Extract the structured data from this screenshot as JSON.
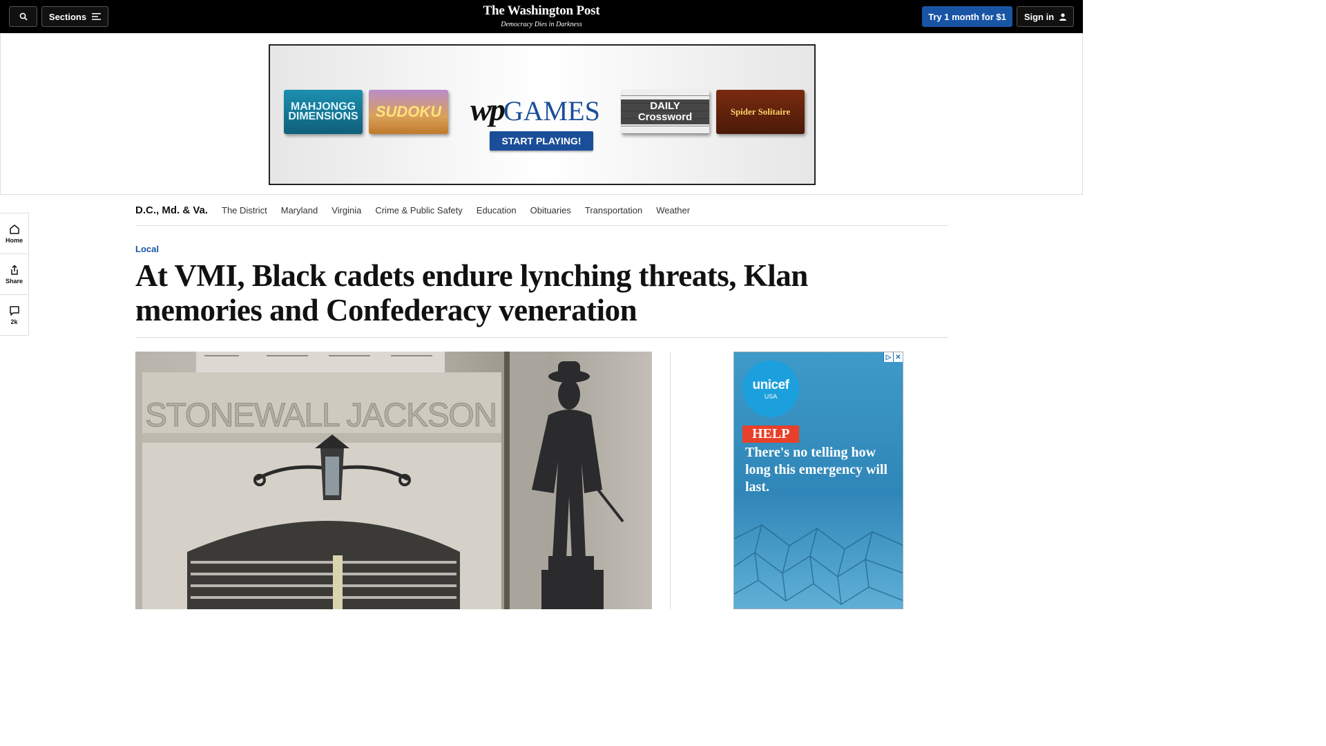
{
  "header": {
    "sections_label": "Sections",
    "brand_name": "The Washington Post",
    "brand_tagline": "Democracy Dies in Darkness",
    "trial_label": "Try 1 month for $1",
    "signin_label": "Sign in"
  },
  "ad_banner": {
    "tiles": [
      "MAHJONGG DIMENSIONS",
      "SUDOKU",
      "DAILY Crossword",
      "Spider Solitaire"
    ],
    "logo_wp": "wp",
    "logo_games": "GAMES",
    "cta": "START PLAYING!"
  },
  "section_nav": {
    "home": "D.C., Md. & Va.",
    "items": [
      "The District",
      "Maryland",
      "Virginia",
      "Crime & Public Safety",
      "Education",
      "Obituaries",
      "Transportation",
      "Weather"
    ]
  },
  "rail": {
    "home_label": "Home",
    "share_label": "Share",
    "comments_count": "2k"
  },
  "article": {
    "kicker": "Local",
    "headline": "At VMI, Black cadets endure lynching threats, Klan memories and Confederacy veneration",
    "photo_inscription": "STONEWALL JACKSON"
  },
  "side_ad": {
    "brand": "unicef",
    "brand_sub": "USA",
    "tag": "HELP",
    "copy": "There's no telling how long this emergency will last."
  }
}
